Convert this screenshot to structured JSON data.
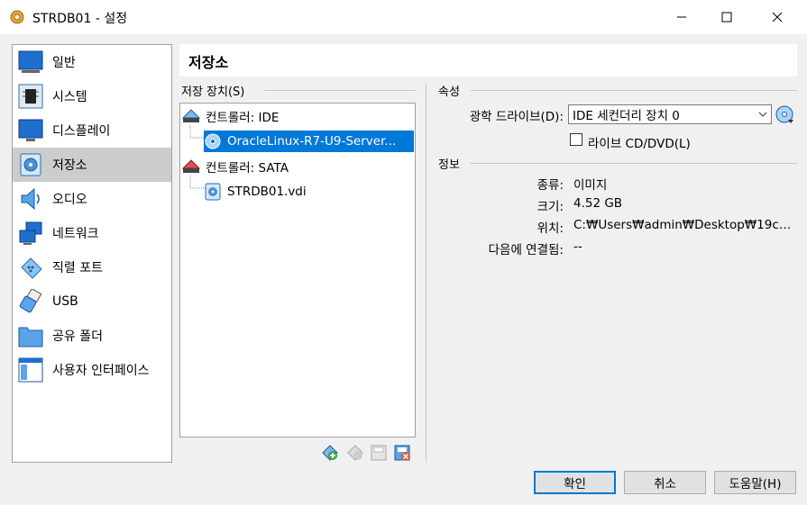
{
  "window": {
    "title": "STRDB01 - 설정"
  },
  "sidebar": {
    "items": [
      {
        "label": "일반",
        "icon": "general-icon"
      },
      {
        "label": "시스템",
        "icon": "system-icon"
      },
      {
        "label": "디스플레이",
        "icon": "display-icon"
      },
      {
        "label": "저장소",
        "icon": "storage-icon",
        "selected": true
      },
      {
        "label": "오디오",
        "icon": "audio-icon"
      },
      {
        "label": "네트워크",
        "icon": "network-icon"
      },
      {
        "label": "직렬 포트",
        "icon": "serial-port-icon"
      },
      {
        "label": "USB",
        "icon": "usb-icon"
      },
      {
        "label": "공유 폴더",
        "icon": "shared-folder-icon"
      },
      {
        "label": "사용자 인터페이스",
        "icon": "user-interface-icon"
      }
    ]
  },
  "page": {
    "title": "저장소"
  },
  "storage": {
    "group_label": "저장 장치(S)",
    "tree": [
      {
        "label": "컨트롤러: IDE",
        "type": "controller"
      },
      {
        "label": "OracleLinux-R7-U9-Server...",
        "type": "optical",
        "selected": true
      },
      {
        "label": "컨트롤러: SATA",
        "type": "controller"
      },
      {
        "label": "STRDB01.vdi",
        "type": "disk"
      }
    ]
  },
  "attributes": {
    "group_label": "속성",
    "drive_label": "광학 드라이브(D):",
    "drive_value": "IDE 세컨더리 장치 0",
    "live_cd_label": "라이브 CD/DVD(L)",
    "live_cd_checked": false
  },
  "info": {
    "group_label": "정보",
    "rows": [
      {
        "label": "종류:",
        "value": "이미지"
      },
      {
        "label": "크기:",
        "value": "4.52 GB"
      },
      {
        "label": "위치:",
        "value": "C:₩Users₩admin₩Desktop₩19c…"
      },
      {
        "label": "다음에 연결됨:",
        "value": "--"
      }
    ]
  },
  "buttons": {
    "ok": "확인",
    "cancel": "취소",
    "help": "도움말(H)"
  },
  "colors": {
    "selection": "#0078d7",
    "sidebar_selected": "#cccccc"
  }
}
